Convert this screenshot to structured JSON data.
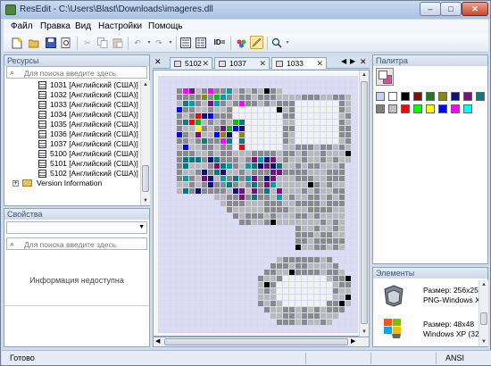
{
  "window": {
    "title": "ResEdit - C:\\Users\\Blast\\Downloads\\imageres.dll",
    "min": "–",
    "max": "□",
    "close": "✕"
  },
  "menu": [
    "Файл",
    "Правка",
    "Вид",
    "Настройки",
    "Помощь"
  ],
  "toolbar": {
    "id_label": "ID=",
    "icons": [
      "new-icon",
      "open-icon",
      "save-icon",
      "preview-icon",
      "cut-icon",
      "copy-icon",
      "paste-icon",
      "undo-icon",
      "redo-icon",
      "resources-icon",
      "properties-icon",
      "id-icon",
      "color-picker-icon",
      "pencil-icon",
      "zoom-icon"
    ]
  },
  "resources": {
    "title": "Ресурсы",
    "search_placeholder": "Для поиска введите здесь",
    "items": [
      {
        "label": "1031 [Английский (США)]"
      },
      {
        "label": "1032 [Английский (США)]"
      },
      {
        "label": "1033 [Английский (США)]"
      },
      {
        "label": "1034 [Английский (США)]"
      },
      {
        "label": "1035 [Английский (США)]"
      },
      {
        "label": "1036 [Английский (США)]"
      },
      {
        "label": "1037 [Английский (США)]"
      },
      {
        "label": "5100 [Английский (США)]"
      },
      {
        "label": "5101 [Английский (США)]"
      },
      {
        "label": "5102 [Английский (США)]"
      }
    ],
    "folder_label": "Version Information"
  },
  "properties": {
    "title": "Свойства",
    "search_placeholder": "Для поиска введите здесь",
    "empty_message": "Информация недоступна"
  },
  "tabs": [
    {
      "label": "5102",
      "active": false
    },
    {
      "label": "1037",
      "active": false
    },
    {
      "label": "1033",
      "active": true
    }
  ],
  "palette": {
    "title": "Палитра",
    "primary": "#ffffff",
    "secondary": "#ee4499",
    "colors": [
      "#c6d0f2",
      "#ffffff",
      "#000000",
      "#7a1010",
      "#1e7a1e",
      "#8a8a10",
      "#10107a",
      "#7a107a",
      "#107a7a",
      "#808080",
      "#c0c0c0",
      "#ff0000",
      "#00ff00",
      "#ffff00",
      "#0000ff",
      "#ff00ff",
      "#00ffff"
    ]
  },
  "elements": {
    "title": "Элементы",
    "items": [
      {
        "line1": "Размер: 256x256",
        "line2": "PNG-Windows X"
      },
      {
        "line1": "Размер: 48x48",
        "line2": "Windows XP (32"
      }
    ]
  },
  "status": {
    "text": "Готово",
    "encoding": "ANSI"
  }
}
